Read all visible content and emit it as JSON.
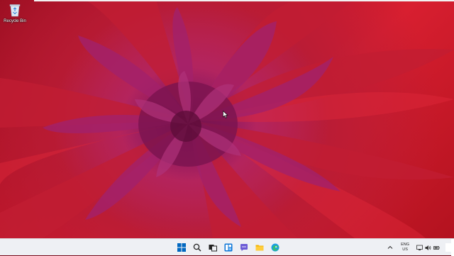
{
  "desktop": {
    "icons": [
      {
        "label": "Recycle Bin",
        "icon": "recycle-bin-icon"
      }
    ]
  },
  "taskbar": {
    "buttons": [
      {
        "name": "start",
        "icon": "windows-logo-icon"
      },
      {
        "name": "search",
        "icon": "search-icon"
      },
      {
        "name": "task-view",
        "icon": "task-view-icon"
      },
      {
        "name": "widgets",
        "icon": "widgets-icon"
      },
      {
        "name": "chat",
        "icon": "chat-icon"
      },
      {
        "name": "file-explorer",
        "icon": "folder-icon"
      },
      {
        "name": "edge",
        "icon": "edge-icon"
      }
    ],
    "tray": {
      "language_line1": "ENG",
      "language_line2": "US",
      "icons": [
        "network-icon",
        "volume-icon",
        "battery-icon"
      ]
    }
  },
  "colors": {
    "taskbar_bg": "#eef0f4",
    "accent_blue": "#0067c0",
    "wallpaper_primary": "#c4182c",
    "wallpaper_center": "#9a1d66"
  }
}
